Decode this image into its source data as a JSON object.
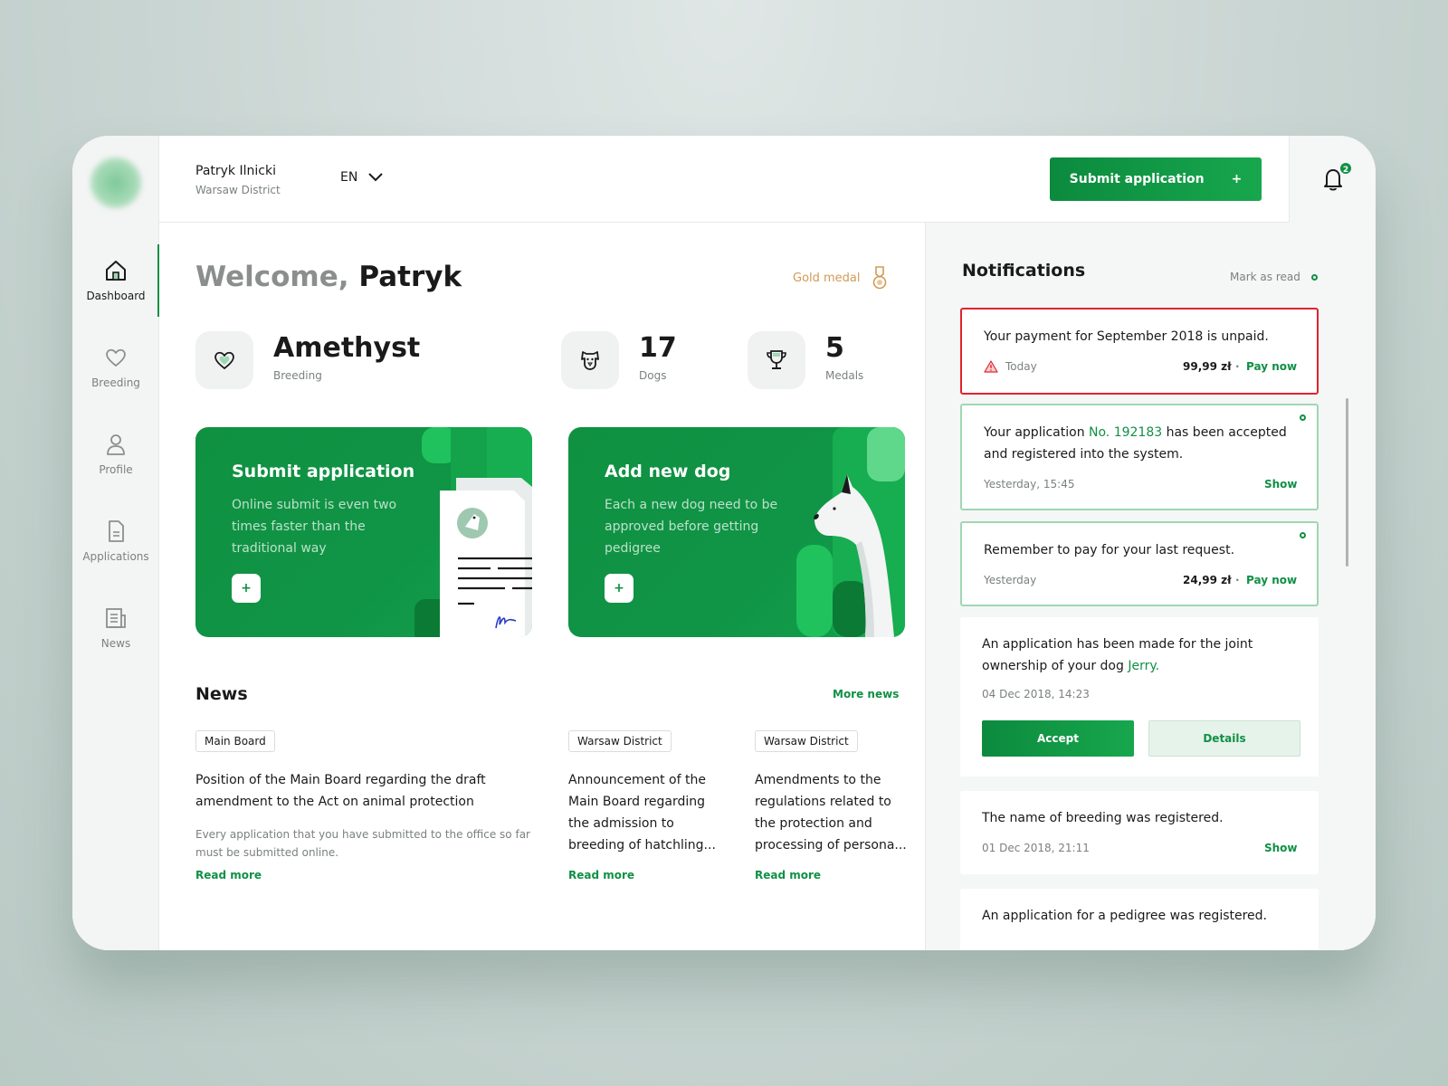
{
  "sidebar": {
    "items": [
      {
        "label": "Dashboard",
        "icon": "home-icon",
        "active": true
      },
      {
        "label": "Breeding",
        "icon": "heart-icon",
        "active": false
      },
      {
        "label": "Profile",
        "icon": "user-icon",
        "active": false
      },
      {
        "label": "Applications",
        "icon": "document-icon",
        "active": false
      },
      {
        "label": "News",
        "icon": "newspaper-icon",
        "active": false
      }
    ]
  },
  "header": {
    "user_name": "Patryk Ilnicki",
    "user_district": "Warsaw District",
    "language": "EN",
    "submit_label": "Submit application",
    "submit_plus": "+",
    "notification_count": "2"
  },
  "main": {
    "welcome_prefix": "Welcome,",
    "welcome_name": "Patryk",
    "medal_label": "Gold medal",
    "stats": [
      {
        "value": "Amethyst",
        "label": "Breeding",
        "icon": "heart-icon"
      },
      {
        "value": "17",
        "label": "Dogs",
        "icon": "dog-icon"
      },
      {
        "value": "5",
        "label": "Medals",
        "icon": "trophy-icon"
      }
    ],
    "cards": [
      {
        "title": "Submit application",
        "description": "Online submit is even two times faster than the traditional way",
        "plus": "+"
      },
      {
        "title": "Add new dog",
        "description": "Each a new dog need to be approved before getting pedigree",
        "plus": "+"
      }
    ],
    "news": {
      "title": "News",
      "more_label": "More news",
      "items": [
        {
          "tag": "Main Board",
          "headline": "Position of the Main Board regarding the draft amendment to the Act on animal protection",
          "body": "Every application that you have submitted to the office so far must be submitted online.",
          "read_more": "Read more"
        },
        {
          "tag": "Warsaw District",
          "headline": "Announcement of the Main Board regarding the admission to breeding of hatchling...",
          "read_more": "Read more"
        },
        {
          "tag": "Warsaw District",
          "headline": "Amendments to the regulations related to the protection and processing of persona...",
          "read_more": "Read more"
        }
      ]
    }
  },
  "notifications": {
    "title": "Notifications",
    "mark_read": "Mark as read",
    "items": [
      {
        "text": "Your payment for September 2018 is unpaid.",
        "time": "Today",
        "amount": "99,99 zł",
        "separator": "·",
        "action": "Pay now"
      },
      {
        "text_a": "Your application ",
        "text_hl": "No. 192183",
        "text_b": " has been accepted and registered into the system.",
        "time": "Yesterday, 15:45",
        "action": "Show"
      },
      {
        "text": "Remember to pay for your last request.",
        "time": "Yesterday",
        "amount": "24,99 zł",
        "separator": "·",
        "action": "Pay now"
      },
      {
        "text_a": "An application has been made for the joint ownership of your dog ",
        "text_hl": "Jerry.",
        "time": "04 Dec 2018, 14:23",
        "accept": "Accept",
        "details": "Details"
      },
      {
        "text": "The name of breeding was registered.",
        "time": "01 Dec 2018, 21:11",
        "action": "Show"
      },
      {
        "text": "An application for a pedigree was registered."
      }
    ]
  },
  "colors": {
    "accent": "#109045",
    "alert": "#e0232e",
    "medal": "#d39a55"
  }
}
